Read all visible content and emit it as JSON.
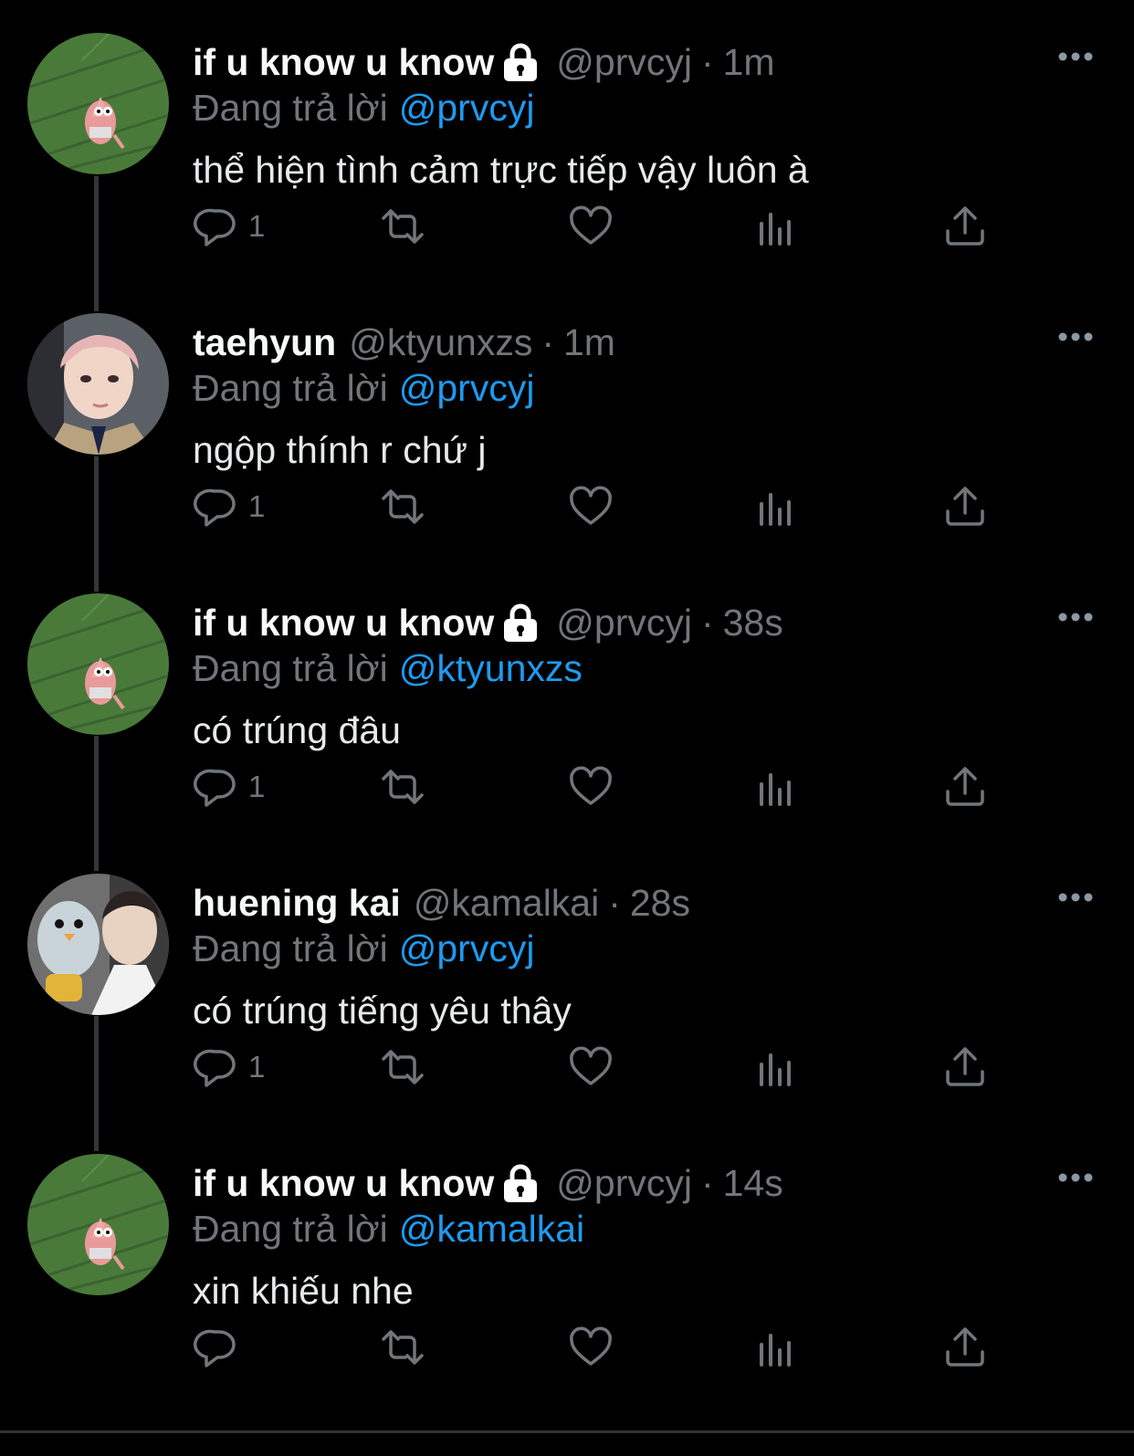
{
  "colors": {
    "background": "#000000",
    "text": "#e7e9ea",
    "muted": "#71767b",
    "mention": "#1d9bf0",
    "thread_line": "#333639"
  },
  "icons": {
    "reply": "reply-icon",
    "retweet": "retweet-icon",
    "like": "heart-icon",
    "views": "views-icon",
    "share": "share-icon",
    "more": "more-icon",
    "lock": "lock-icon"
  },
  "reply_prefix": "Đang trả lời",
  "tweets": [
    {
      "display_name": "if u know u know",
      "protected": true,
      "handle": "@prvcyj",
      "time": "1m",
      "reply_to": "@prvcyj",
      "text": "thể hiện tình cảm trực tiếp vậy luôn à",
      "reply_count": "1"
    },
    {
      "display_name": "taehyun",
      "protected": false,
      "handle": "@ktyunxzs",
      "time": "1m",
      "reply_to": "@prvcyj",
      "text": "ngộp thính r chứ j",
      "reply_count": "1"
    },
    {
      "display_name": "if u know u know",
      "protected": true,
      "handle": "@prvcyj",
      "time": "38s",
      "reply_to": "@ktyunxzs",
      "text": "có trúng đâu",
      "reply_count": "1"
    },
    {
      "display_name": "huening kai",
      "protected": false,
      "handle": "@kamalkai",
      "time": "28s",
      "reply_to": "@prvcyj",
      "text": "có trúng tiếng yêu thây",
      "reply_count": "1"
    },
    {
      "display_name": "if u know u know",
      "protected": true,
      "handle": "@prvcyj",
      "time": "14s",
      "reply_to": "@kamalkai",
      "text": "xin khiếu nhe",
      "reply_count": ""
    }
  ]
}
